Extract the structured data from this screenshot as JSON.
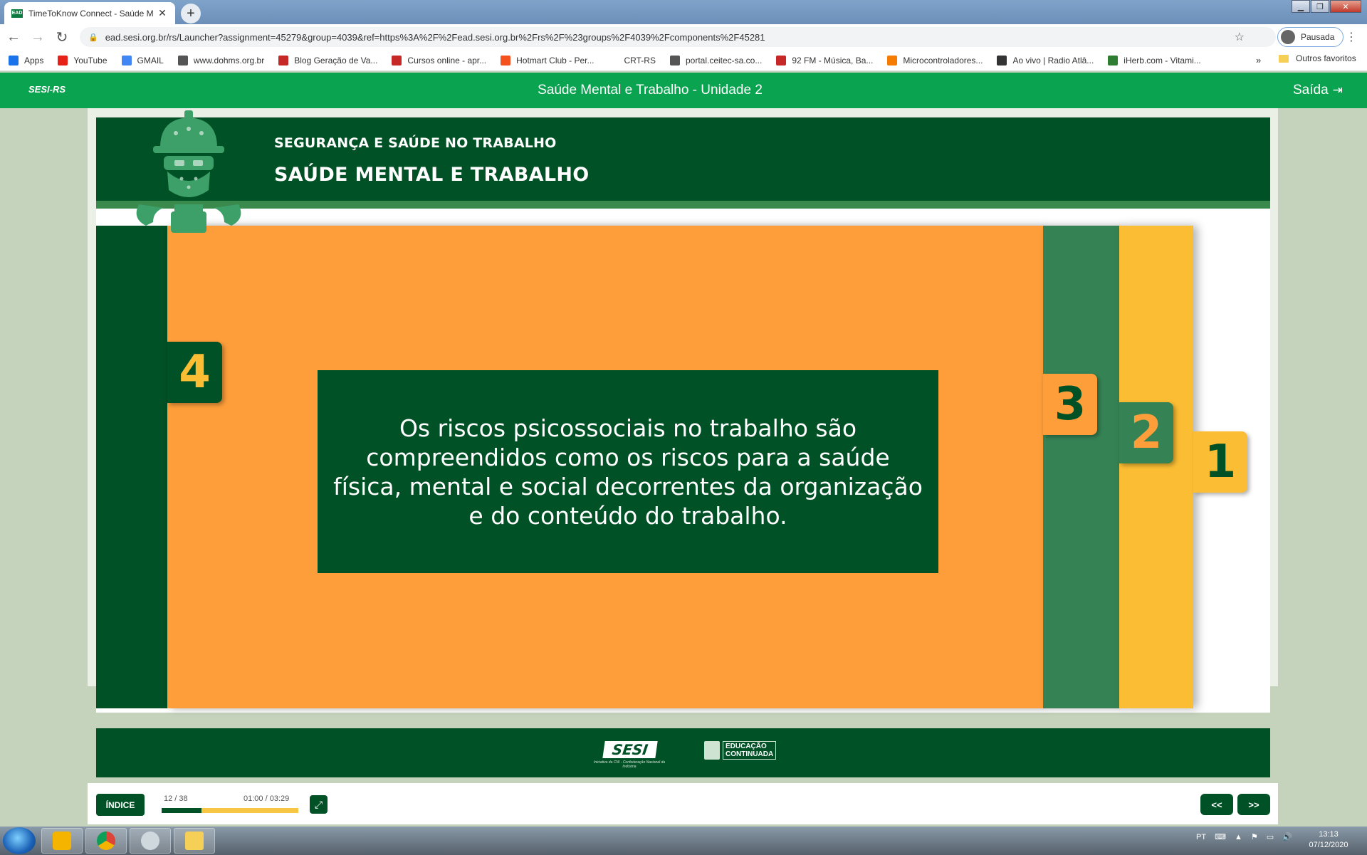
{
  "browser": {
    "tab_title": "TimeToKnow Connect - Saúde M",
    "tab_favicon": "EAD",
    "url": "ead.sesi.org.br/rs/Launcher?assignment=45279&group=4039&ref=https%3A%2F%2Fead.sesi.org.br%2Frs%2F%23groups%2F4039%2Fcomponents%2F45281",
    "profile_label": "Pausada",
    "bookmarks": [
      {
        "label": "Apps",
        "icon": "apps-grid-icon",
        "color": "#1a73e8"
      },
      {
        "label": "YouTube",
        "icon": "youtube-icon",
        "color": "#e62117"
      },
      {
        "label": "GMAIL",
        "icon": "google-icon",
        "color": "#4285f4"
      },
      {
        "label": "www.dohms.org.br",
        "icon": "globe-icon",
        "color": "#555555"
      },
      {
        "label": "Blog Geração de Va...",
        "icon": "blog-icon",
        "color": "#c62828"
      },
      {
        "label": "Cursos online - apr...",
        "icon": "cursos-icon",
        "color": "#c62828"
      },
      {
        "label": "Hotmart Club - Per...",
        "icon": "hotmart-icon",
        "color": "#f4511e"
      },
      {
        "label": "CRT-RS",
        "icon": "crt-icon",
        "color": "#ffffff"
      },
      {
        "label": "portal.ceitec-sa.co...",
        "icon": "globe-icon",
        "color": "#555555"
      },
      {
        "label": "92 FM - Música, Ba...",
        "icon": "radio-92-icon",
        "color": "#c62828"
      },
      {
        "label": "Microcontroladores...",
        "icon": "blogger-icon",
        "color": "#f57c00"
      },
      {
        "label": "Ao vivo | Radio Atlâ...",
        "icon": "radio-icon",
        "color": "#333333"
      },
      {
        "label": "iHerb.com - Vitami...",
        "icon": "iherb-icon",
        "color": "#2e7d32"
      }
    ],
    "bookmarks_more": "»",
    "other_bookmarks": "Outros favoritos"
  },
  "app": {
    "logo": "SESI-RS",
    "title": "Saúde Mental e Trabalho - Unidade 2",
    "exit_label": "Saída"
  },
  "slide": {
    "kicker": "SEGURANÇA E SAÚDE NO TRABALHO",
    "course_title": "SAÚDE MENTAL E TRABALHO",
    "tabs": [
      "4",
      "3",
      "2",
      "1"
    ],
    "body_text": "Os riscos psicossociais no trabalho são compreendidos como os riscos para a saúde física, mental e social decorrentes da organização e do conteúdo do trabalho.",
    "footer_logo_sesi": "SESI",
    "footer_logo_sesi_sub": "Iniciativa da CNI - Confederação Nacional da Indústria",
    "footer_logo_edu_line1": "EDUCAÇÃO",
    "footer_logo_edu_line2": "CONTINUADA"
  },
  "player": {
    "index_label": "ÍNDICE",
    "page_counter": "12 / 38",
    "time_counter": "01:00 / 03:29",
    "progress_fraction": 0.29,
    "prev_label": "<<",
    "next_label": ">>"
  },
  "taskbar": {
    "language": "PT",
    "time": "13:13",
    "date": "07/12/2020"
  },
  "colors": {
    "sesi_green": "#0aa350",
    "dark_green": "#005125",
    "orange": "#fe9e3a",
    "mid_green": "#358355",
    "yellow": "#fbbd33"
  }
}
